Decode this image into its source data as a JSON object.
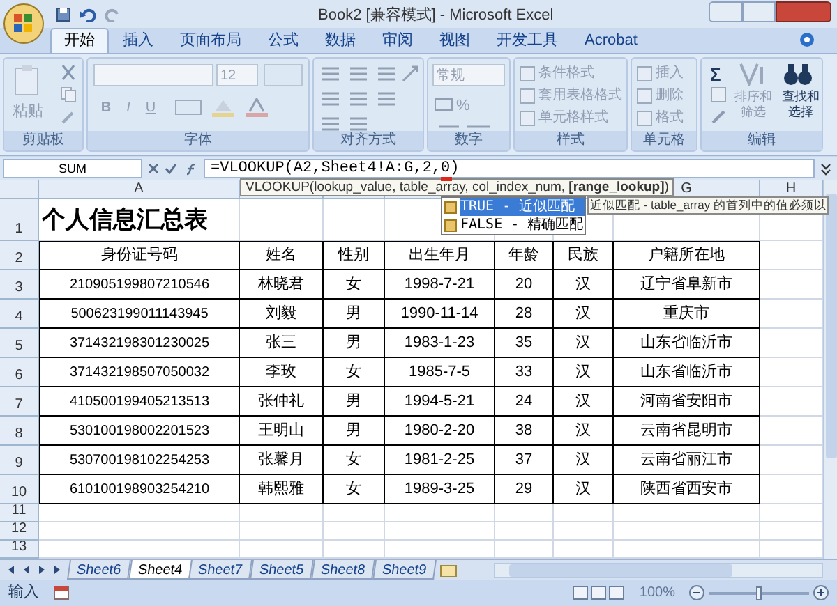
{
  "window": {
    "title": "Book2  [兼容模式] - Microsoft Excel"
  },
  "ribbon_tabs": [
    {
      "label": "开始",
      "selected": true
    },
    {
      "label": "插入",
      "selected": false
    },
    {
      "label": "页面布局",
      "selected": false
    },
    {
      "label": "公式",
      "selected": false
    },
    {
      "label": "数据",
      "selected": false
    },
    {
      "label": "审阅",
      "selected": false
    },
    {
      "label": "视图",
      "selected": false
    },
    {
      "label": "开发工具",
      "selected": false
    },
    {
      "label": "Acrobat",
      "selected": false
    }
  ],
  "ribbon_groups": [
    {
      "kind": "clipboard",
      "label": "剪贴板",
      "disabled": true,
      "items": [
        "粘贴"
      ]
    },
    {
      "kind": "font",
      "label": "字体",
      "disabled": true,
      "items": [
        "12",
        "B",
        "I",
        "U"
      ]
    },
    {
      "kind": "alignment",
      "label": "对齐方式",
      "disabled": true
    },
    {
      "kind": "number",
      "label": "数字",
      "disabled": true,
      "items": [
        "常规",
        "%"
      ]
    },
    {
      "kind": "list",
      "label": "样式",
      "disabled": true,
      "items": [
        "条件格式",
        "套用表格格式",
        "单元格样式"
      ]
    },
    {
      "kind": "list",
      "label": "单元格",
      "disabled": true,
      "items": [
        "插入",
        "删除",
        "格式"
      ]
    },
    {
      "kind": "editing",
      "label": "编辑",
      "disabled": false,
      "items": [
        "Σ",
        "排序和筛选",
        "查找和选择"
      ]
    }
  ],
  "formula_bar": {
    "name_box": "SUM",
    "formula": "=VLOOKUP(A2,Sheet4!A:G,2,0)"
  },
  "function_tooltip": "VLOOKUP(lookup_value, table_array, col_index_num, **[range_lookup]**)",
  "autocomplete": [
    {
      "label": "TRUE - 近似匹配",
      "selected": true
    },
    {
      "label": "FALSE - 精确匹配",
      "selected": false
    }
  ],
  "autocomplete_hint": "近似匹配 - table_array 的首列中的值必须以",
  "column_headers": [
    "A",
    "G",
    "H"
  ],
  "row_numbers": [
    "1",
    "2",
    "3",
    "4",
    "5",
    "6",
    "7",
    "8",
    "9",
    "10",
    "11",
    "12",
    "13"
  ],
  "sheet_title": "个人信息汇总表",
  "table": {
    "columns": [
      "身份证号码",
      "姓名",
      "性别",
      "出生年月",
      "年龄",
      "民族",
      "户籍所在地"
    ],
    "rows": [
      [
        "210905199807210546",
        "林晓君",
        "女",
        "1998-7-21",
        "20",
        "汉",
        "辽宁省阜新市"
      ],
      [
        "500623199011143945",
        "刘毅",
        "男",
        "1990-11-14",
        "28",
        "汉",
        "重庆市"
      ],
      [
        "371432198301230025",
        "张三",
        "男",
        "1983-1-23",
        "35",
        "汉",
        "山东省临沂市"
      ],
      [
        "371432198507050032",
        "李玫",
        "女",
        "1985-7-5",
        "33",
        "汉",
        "山东省临沂市"
      ],
      [
        "410500199405213513",
        "张仲礼",
        "男",
        "1994-5-21",
        "24",
        "汉",
        "河南省安阳市"
      ],
      [
        "530100198002201523",
        "王明山",
        "男",
        "1980-2-20",
        "38",
        "汉",
        "云南省昆明市"
      ],
      [
        "530700198102254253",
        "张馨月",
        "女",
        "1981-2-25",
        "37",
        "汉",
        "云南省丽江市"
      ],
      [
        "610100198903254210",
        "韩熙雅",
        "女",
        "1989-3-25",
        "29",
        "汉",
        "陕西省西安市"
      ]
    ]
  },
  "sheet_tabs": [
    {
      "label": "Sheet6",
      "selected": false
    },
    {
      "label": "Sheet4",
      "selected": true
    },
    {
      "label": "Sheet7",
      "selected": false
    },
    {
      "label": "Sheet5",
      "selected": false
    },
    {
      "label": "Sheet8",
      "selected": false
    },
    {
      "label": "Sheet9",
      "selected": false
    }
  ],
  "status_bar": {
    "mode": "输入",
    "zoom": "100%",
    "zoom_slider": {
      "level": 0.5
    }
  }
}
